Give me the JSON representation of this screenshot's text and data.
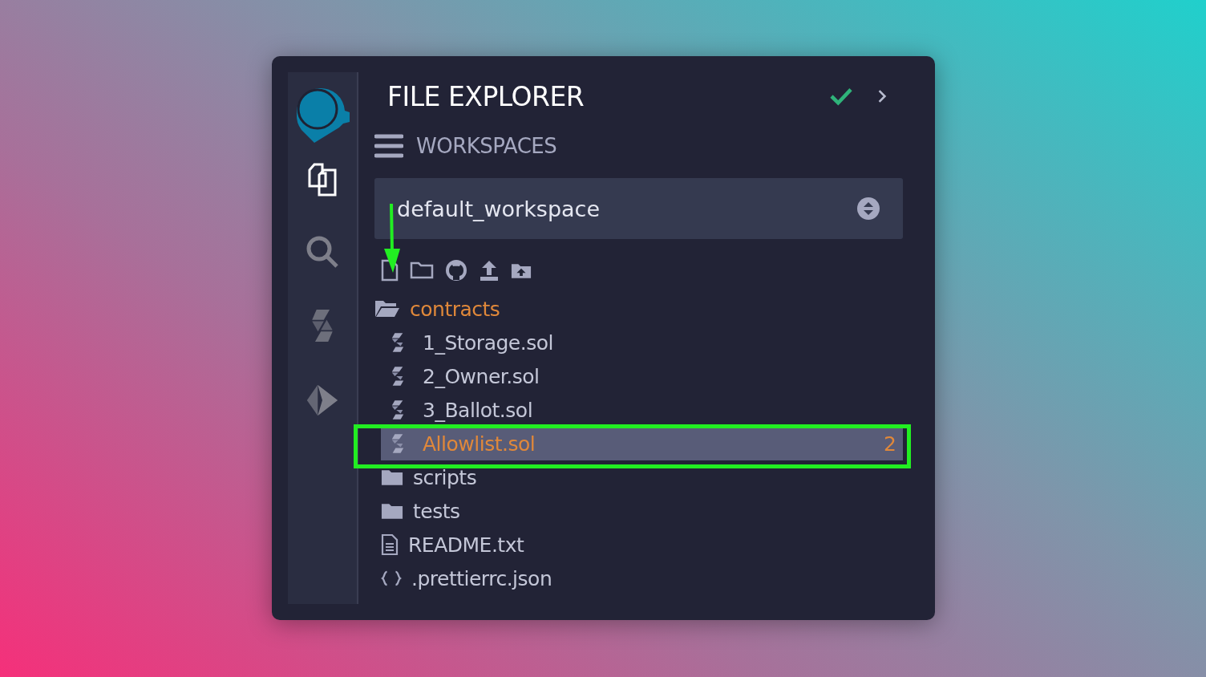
{
  "sidebar": {
    "items": [
      {
        "selected": true
      },
      {
        "selected": false
      },
      {
        "selected": false
      },
      {
        "selected": false
      }
    ]
  },
  "panel": {
    "title": "FILE EXPLORER",
    "status_ok": true
  },
  "workspaces": {
    "label": "WORKSPACES",
    "selected_workspace": "default_workspace"
  },
  "tree": [
    {
      "kind": "folder",
      "name": "contracts",
      "expanded": true,
      "warning": true,
      "selected": false,
      "children": [
        {
          "kind": "sol",
          "name": "1_Storage.sol",
          "warning": false,
          "selected": false
        },
        {
          "kind": "sol",
          "name": "2_Owner.sol",
          "warning": false,
          "selected": false
        },
        {
          "kind": "sol",
          "name": "3_Ballot.sol",
          "warning": false,
          "selected": false
        },
        {
          "kind": "sol",
          "name": "Allowlist.sol",
          "warning": true,
          "selected": true,
          "badge": "2"
        }
      ]
    },
    {
      "kind": "folder",
      "name": "scripts",
      "expanded": false,
      "warning": false,
      "selected": false
    },
    {
      "kind": "folder",
      "name": "tests",
      "expanded": false,
      "warning": false,
      "selected": false
    },
    {
      "kind": "text",
      "name": "README.txt",
      "warning": false,
      "selected": false
    },
    {
      "kind": "json",
      "name": ".prettierrc.json",
      "warning": false,
      "selected": false
    }
  ]
}
